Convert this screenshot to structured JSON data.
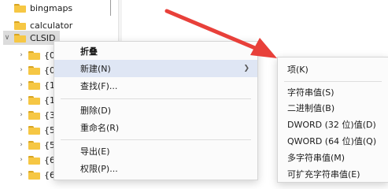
{
  "tree": {
    "items": [
      {
        "label": "bingmaps",
        "expander": ""
      },
      {
        "label": "calculator",
        "expander": ""
      },
      {
        "label": "CLSID",
        "expander": "v"
      },
      {
        "label": "{0",
        "expander": ">"
      },
      {
        "label": "{0",
        "expander": ">"
      },
      {
        "label": "{1",
        "expander": ">"
      },
      {
        "label": "{1",
        "expander": ">"
      },
      {
        "label": "{3",
        "expander": ">"
      },
      {
        "label": "{5",
        "expander": ">"
      },
      {
        "label": "{5",
        "expander": ">"
      },
      {
        "label": "{6",
        "expander": ">"
      },
      {
        "label": "{6",
        "expander": ">"
      }
    ]
  },
  "context_menu": {
    "items": [
      {
        "label": "折叠"
      },
      {
        "label": "新建(N)"
      },
      {
        "label": "查找(F)..."
      },
      {
        "label": "删除(D)"
      },
      {
        "label": "重命名(R)"
      },
      {
        "label": "导出(E)"
      },
      {
        "label": "权限(P)..."
      }
    ]
  },
  "submenu": {
    "items": [
      {
        "label": "项(K)"
      },
      {
        "label": "字符串值(S)"
      },
      {
        "label": "二进制值(B)"
      },
      {
        "label": "DWORD (32 位)值(D)"
      },
      {
        "label": "QWORD (64 位)值(Q)"
      },
      {
        "label": "多字符串值(M)"
      },
      {
        "label": "可扩充字符串值(E)"
      }
    ]
  },
  "colors": {
    "annotation_arrow": "#e8403a",
    "highlight": "#dfe6f4",
    "folder": "#f6c744"
  }
}
